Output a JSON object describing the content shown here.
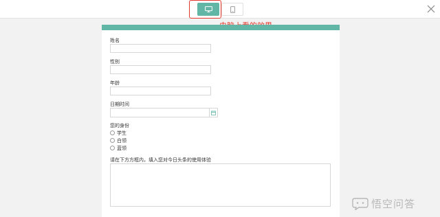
{
  "annotation": "电脑上看的效果",
  "form": {
    "fields": {
      "name_label": "姓名",
      "gender_label": "性别",
      "age_label": "年龄",
      "datetime_label": "日期时间",
      "identity_label": "您的身份",
      "identity_options": [
        "学生",
        "白领",
        "蓝领"
      ],
      "feedback_label": "请在下方方框内，填入您对今日头条的使用体验"
    }
  },
  "watermark": {
    "text": "悟空问答"
  },
  "colors": {
    "accent": "#62b6a5",
    "annotation": "#e2382b"
  },
  "icons": {
    "desktop": "monitor-icon",
    "mobile": "phone-icon",
    "close": "close-icon",
    "date": "calendar-icon",
    "watermark": "chat-bubble-icon"
  }
}
